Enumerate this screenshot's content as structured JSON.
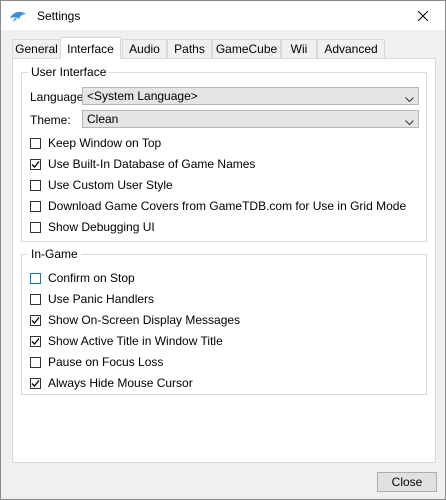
{
  "window": {
    "title": "Settings"
  },
  "tabs": [
    {
      "label": "General"
    },
    {
      "label": "Interface"
    },
    {
      "label": "Audio"
    },
    {
      "label": "Paths"
    },
    {
      "label": "GameCube"
    },
    {
      "label": "Wii"
    },
    {
      "label": "Advanced"
    }
  ],
  "active_tab": "Interface",
  "user_interface": {
    "title": "User Interface",
    "language_label": "Language:",
    "language_value": "<System Language>",
    "theme_label": "Theme:",
    "theme_value": "Clean",
    "options": [
      {
        "label": "Keep Window on Top",
        "checked": false
      },
      {
        "label": "Use Built-In Database of Game Names",
        "checked": true
      },
      {
        "label": "Use Custom User Style",
        "checked": false
      },
      {
        "label": "Download Game Covers from GameTDB.com for Use in Grid Mode",
        "checked": false
      },
      {
        "label": "Show Debugging UI",
        "checked": false
      }
    ]
  },
  "in_game": {
    "title": "In-Game",
    "options": [
      {
        "label": "Confirm on Stop",
        "checked": false
      },
      {
        "label": "Use Panic Handlers",
        "checked": false
      },
      {
        "label": "Show On-Screen Display Messages",
        "checked": true
      },
      {
        "label": "Show Active Title in Window Title",
        "checked": true
      },
      {
        "label": "Pause on Focus Loss",
        "checked": false
      },
      {
        "label": "Always Hide Mouse Cursor",
        "checked": true
      }
    ]
  },
  "footer": {
    "close_label": "Close"
  }
}
